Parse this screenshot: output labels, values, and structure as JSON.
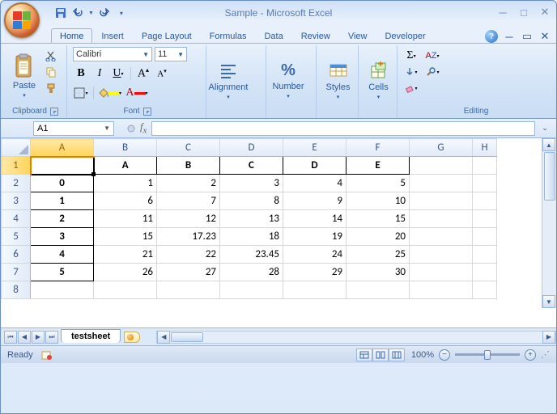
{
  "title": "Sample - Microsoft Excel",
  "qat": {
    "save": "Save",
    "undo": "Undo",
    "redo": "Redo"
  },
  "tabs": [
    "Home",
    "Insert",
    "Page Layout",
    "Formulas",
    "Data",
    "Review",
    "View",
    "Developer"
  ],
  "active_tab": "Home",
  "ribbon": {
    "clipboard": {
      "label": "Clipboard",
      "paste": "Paste"
    },
    "font": {
      "label": "Font",
      "family": "Calibri",
      "size": "11",
      "bold": "B",
      "italic": "I",
      "underline": "U"
    },
    "alignment": {
      "label": "Alignment"
    },
    "number": {
      "label": "Number"
    },
    "styles": {
      "label": "Styles"
    },
    "cells": {
      "label": "Cells"
    },
    "editing": {
      "label": "Editing"
    }
  },
  "namebox": "A1",
  "formula": "",
  "columns": [
    "A",
    "B",
    "C",
    "D",
    "E",
    "F",
    "G",
    "H"
  ],
  "rows": [
    "1",
    "2",
    "3",
    "4",
    "5",
    "6",
    "7",
    "8"
  ],
  "selected": {
    "row": 0,
    "col": 0
  },
  "sheet_tab": "testsheet",
  "status": "Ready",
  "zoom": "100%",
  "chart_data": {
    "type": "table",
    "headers": [
      "",
      "A",
      "B",
      "C",
      "D",
      "E"
    ],
    "index": [
      "0",
      "1",
      "2",
      "3",
      "4",
      "5"
    ],
    "rows": [
      [
        1,
        2,
        3,
        4,
        5
      ],
      [
        6,
        7,
        8,
        9,
        10
      ],
      [
        11,
        12,
        13,
        14,
        15
      ],
      [
        15,
        17.23,
        18,
        19,
        20
      ],
      [
        21,
        22,
        23.45,
        24,
        25
      ],
      [
        26,
        27,
        28,
        29,
        30
      ]
    ]
  }
}
